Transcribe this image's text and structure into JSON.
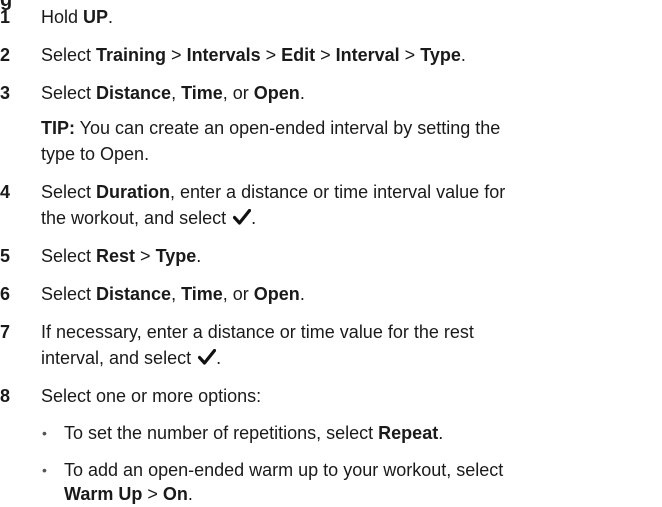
{
  "heading_fragment": "g",
  "steps": [
    {
      "num": "1",
      "parts": [
        "Hold ",
        "UP",
        "."
      ]
    },
    {
      "num": "2",
      "parts": [
        "Select ",
        "Training",
        " > ",
        "Intervals",
        " > ",
        "Edit",
        " > ",
        "Interval",
        " > ",
        "Type",
        "."
      ]
    },
    {
      "num": "3",
      "parts": [
        "Select ",
        "Distance",
        ", ",
        "Time",
        ", or ",
        "Open",
        "."
      ]
    },
    {
      "num": "4",
      "line1": [
        "Select ",
        "Duration",
        ", enter a distance or time interval value for"
      ],
      "line2": [
        "the workout, and select ",
        "."
      ]
    },
    {
      "num": "5",
      "parts": [
        "Select ",
        "Rest",
        " > ",
        "Type",
        "."
      ]
    },
    {
      "num": "6",
      "parts": [
        "Select ",
        "Distance",
        ", ",
        "Time",
        ", or ",
        "Open",
        "."
      ]
    },
    {
      "num": "7",
      "line1": [
        "If necessary, enter a distance or time value for the rest"
      ],
      "line2": [
        "interval, and select ",
        "."
      ]
    },
    {
      "num": "8",
      "parts": [
        "Select one or more options:"
      ]
    }
  ],
  "tip": {
    "label": "TIP:",
    "line1": " You can create an open-ended interval by setting the",
    "line2": "type to Open."
  },
  "bullets": [
    {
      "dot": "•",
      "parts": [
        "To set the number of repetitions, select ",
        "Repeat",
        "."
      ]
    },
    {
      "dot": "•",
      "line1": [
        "To add an open-ended warm up to your workout, select"
      ],
      "line2": [
        "Warm Up",
        " > ",
        "On",
        "."
      ]
    }
  ],
  "icons": {
    "check": "checkmark-icon"
  }
}
